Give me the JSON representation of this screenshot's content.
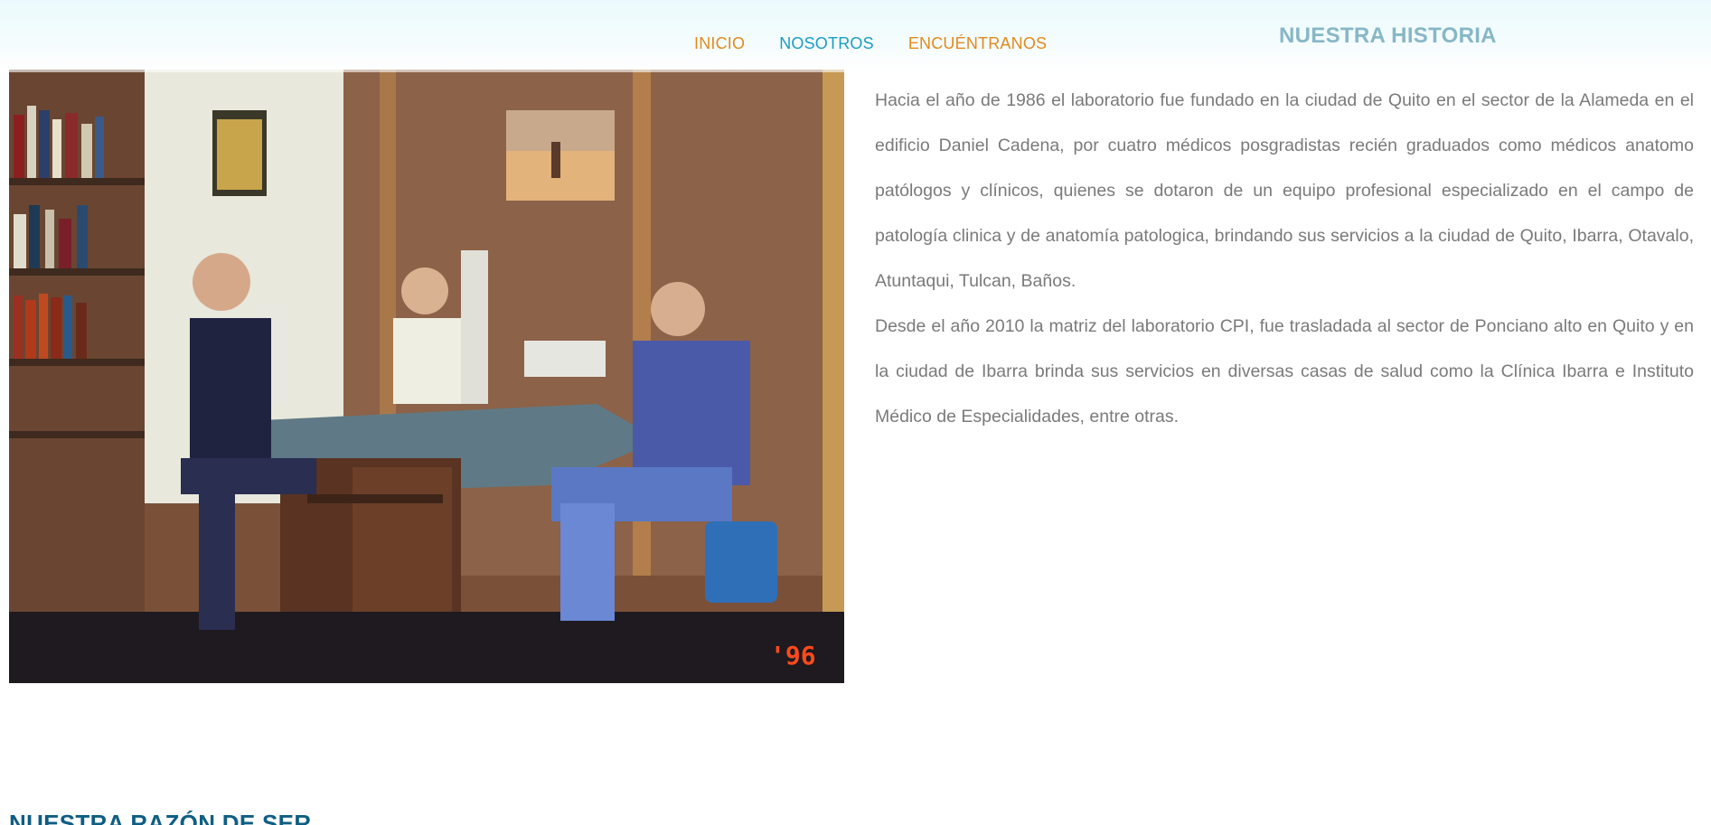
{
  "nav": {
    "items": [
      {
        "label": "INICIO",
        "color": "#e08a1e"
      },
      {
        "label": "NOSOTROS",
        "color": "#1a9cc2"
      },
      {
        "label": "ENCUÉNTRANOS",
        "color": "#e08a1e"
      }
    ]
  },
  "history": {
    "title": "NUESTRA HISTORIA",
    "paragraphs": [
      "Hacia el año de 1986 el laboratorio fue fundado en la ciudad de Quito en el sector de la Alameda en el edificio Daniel Cadena, por cuatro médicos posgradistas recién graduados como médicos anatomo patólogos y clínicos, quienes se dotaron de un equipo profesional especializado en el campo de patología clinica y de anatomía patologica, brindando sus servicios a la ciudad de Quito, Ibarra, Otavalo, Atuntaqui, Tulcan, Baños.",
      "Desde el año 2010 la matriz del laboratorio CPI, fue trasladada al sector de Ponciano alto en Quito y en la ciudad de Ibarra brinda sus servicios en diversas casas de salud como la Clínica Ibarra e Instituto Médico de Especialidades, entre otras."
    ],
    "photo_date_stamp": "'96"
  },
  "mission": {
    "title": "NUESTRA RAZÓN DE SER"
  },
  "colors": {
    "accent_orange": "#e08a1e",
    "accent_blue": "#1a9cc2",
    "history_title": "#87b7c6",
    "section_title": "#0f5e84",
    "body_text": "#7a7a7a"
  }
}
